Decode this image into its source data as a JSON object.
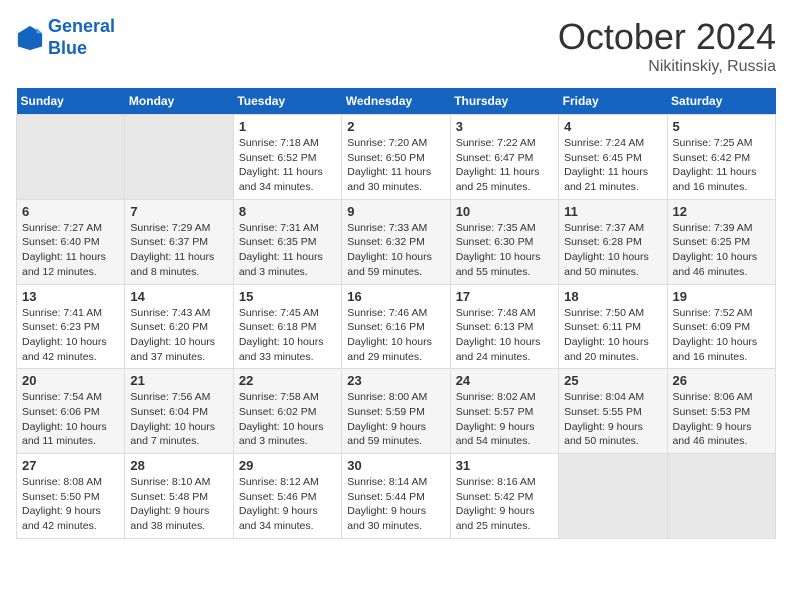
{
  "header": {
    "logo_line1": "General",
    "logo_line2": "Blue",
    "month": "October 2024",
    "location": "Nikitinskiy, Russia"
  },
  "days_of_week": [
    "Sunday",
    "Monday",
    "Tuesday",
    "Wednesday",
    "Thursday",
    "Friday",
    "Saturday"
  ],
  "weeks": [
    [
      {
        "day": "",
        "empty": true
      },
      {
        "day": "",
        "empty": true
      },
      {
        "day": "1",
        "sunrise": "Sunrise: 7:18 AM",
        "sunset": "Sunset: 6:52 PM",
        "daylight": "Daylight: 11 hours and 34 minutes."
      },
      {
        "day": "2",
        "sunrise": "Sunrise: 7:20 AM",
        "sunset": "Sunset: 6:50 PM",
        "daylight": "Daylight: 11 hours and 30 minutes."
      },
      {
        "day": "3",
        "sunrise": "Sunrise: 7:22 AM",
        "sunset": "Sunset: 6:47 PM",
        "daylight": "Daylight: 11 hours and 25 minutes."
      },
      {
        "day": "4",
        "sunrise": "Sunrise: 7:24 AM",
        "sunset": "Sunset: 6:45 PM",
        "daylight": "Daylight: 11 hours and 21 minutes."
      },
      {
        "day": "5",
        "sunrise": "Sunrise: 7:25 AM",
        "sunset": "Sunset: 6:42 PM",
        "daylight": "Daylight: 11 hours and 16 minutes."
      }
    ],
    [
      {
        "day": "6",
        "sunrise": "Sunrise: 7:27 AM",
        "sunset": "Sunset: 6:40 PM",
        "daylight": "Daylight: 11 hours and 12 minutes."
      },
      {
        "day": "7",
        "sunrise": "Sunrise: 7:29 AM",
        "sunset": "Sunset: 6:37 PM",
        "daylight": "Daylight: 11 hours and 8 minutes."
      },
      {
        "day": "8",
        "sunrise": "Sunrise: 7:31 AM",
        "sunset": "Sunset: 6:35 PM",
        "daylight": "Daylight: 11 hours and 3 minutes."
      },
      {
        "day": "9",
        "sunrise": "Sunrise: 7:33 AM",
        "sunset": "Sunset: 6:32 PM",
        "daylight": "Daylight: 10 hours and 59 minutes."
      },
      {
        "day": "10",
        "sunrise": "Sunrise: 7:35 AM",
        "sunset": "Sunset: 6:30 PM",
        "daylight": "Daylight: 10 hours and 55 minutes."
      },
      {
        "day": "11",
        "sunrise": "Sunrise: 7:37 AM",
        "sunset": "Sunset: 6:28 PM",
        "daylight": "Daylight: 10 hours and 50 minutes."
      },
      {
        "day": "12",
        "sunrise": "Sunrise: 7:39 AM",
        "sunset": "Sunset: 6:25 PM",
        "daylight": "Daylight: 10 hours and 46 minutes."
      }
    ],
    [
      {
        "day": "13",
        "sunrise": "Sunrise: 7:41 AM",
        "sunset": "Sunset: 6:23 PM",
        "daylight": "Daylight: 10 hours and 42 minutes."
      },
      {
        "day": "14",
        "sunrise": "Sunrise: 7:43 AM",
        "sunset": "Sunset: 6:20 PM",
        "daylight": "Daylight: 10 hours and 37 minutes."
      },
      {
        "day": "15",
        "sunrise": "Sunrise: 7:45 AM",
        "sunset": "Sunset: 6:18 PM",
        "daylight": "Daylight: 10 hours and 33 minutes."
      },
      {
        "day": "16",
        "sunrise": "Sunrise: 7:46 AM",
        "sunset": "Sunset: 6:16 PM",
        "daylight": "Daylight: 10 hours and 29 minutes."
      },
      {
        "day": "17",
        "sunrise": "Sunrise: 7:48 AM",
        "sunset": "Sunset: 6:13 PM",
        "daylight": "Daylight: 10 hours and 24 minutes."
      },
      {
        "day": "18",
        "sunrise": "Sunrise: 7:50 AM",
        "sunset": "Sunset: 6:11 PM",
        "daylight": "Daylight: 10 hours and 20 minutes."
      },
      {
        "day": "19",
        "sunrise": "Sunrise: 7:52 AM",
        "sunset": "Sunset: 6:09 PM",
        "daylight": "Daylight: 10 hours and 16 minutes."
      }
    ],
    [
      {
        "day": "20",
        "sunrise": "Sunrise: 7:54 AM",
        "sunset": "Sunset: 6:06 PM",
        "daylight": "Daylight: 10 hours and 11 minutes."
      },
      {
        "day": "21",
        "sunrise": "Sunrise: 7:56 AM",
        "sunset": "Sunset: 6:04 PM",
        "daylight": "Daylight: 10 hours and 7 minutes."
      },
      {
        "day": "22",
        "sunrise": "Sunrise: 7:58 AM",
        "sunset": "Sunset: 6:02 PM",
        "daylight": "Daylight: 10 hours and 3 minutes."
      },
      {
        "day": "23",
        "sunrise": "Sunrise: 8:00 AM",
        "sunset": "Sunset: 5:59 PM",
        "daylight": "Daylight: 9 hours and 59 minutes."
      },
      {
        "day": "24",
        "sunrise": "Sunrise: 8:02 AM",
        "sunset": "Sunset: 5:57 PM",
        "daylight": "Daylight: 9 hours and 54 minutes."
      },
      {
        "day": "25",
        "sunrise": "Sunrise: 8:04 AM",
        "sunset": "Sunset: 5:55 PM",
        "daylight": "Daylight: 9 hours and 50 minutes."
      },
      {
        "day": "26",
        "sunrise": "Sunrise: 8:06 AM",
        "sunset": "Sunset: 5:53 PM",
        "daylight": "Daylight: 9 hours and 46 minutes."
      }
    ],
    [
      {
        "day": "27",
        "sunrise": "Sunrise: 8:08 AM",
        "sunset": "Sunset: 5:50 PM",
        "daylight": "Daylight: 9 hours and 42 minutes."
      },
      {
        "day": "28",
        "sunrise": "Sunrise: 8:10 AM",
        "sunset": "Sunset: 5:48 PM",
        "daylight": "Daylight: 9 hours and 38 minutes."
      },
      {
        "day": "29",
        "sunrise": "Sunrise: 8:12 AM",
        "sunset": "Sunset: 5:46 PM",
        "daylight": "Daylight: 9 hours and 34 minutes."
      },
      {
        "day": "30",
        "sunrise": "Sunrise: 8:14 AM",
        "sunset": "Sunset: 5:44 PM",
        "daylight": "Daylight: 9 hours and 30 minutes."
      },
      {
        "day": "31",
        "sunrise": "Sunrise: 8:16 AM",
        "sunset": "Sunset: 5:42 PM",
        "daylight": "Daylight: 9 hours and 25 minutes."
      },
      {
        "day": "",
        "empty": true
      },
      {
        "day": "",
        "empty": true
      }
    ]
  ]
}
